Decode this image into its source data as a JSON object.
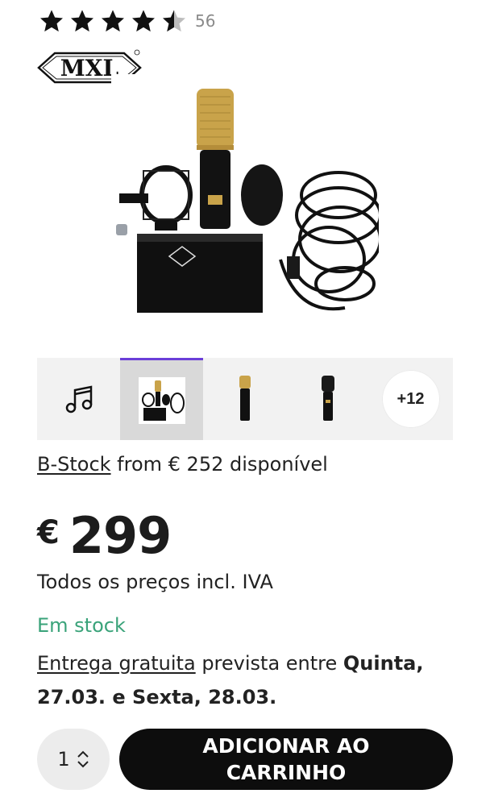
{
  "rating": {
    "value": 4.5,
    "max": 5,
    "count": "56"
  },
  "brand": {
    "name": "MXL"
  },
  "thumbnails": {
    "more_label": "+12",
    "icons": [
      "music-note-icon",
      "product-set-thumbnail",
      "microphone-gold-thumbnail",
      "microphone-black-thumbnail"
    ]
  },
  "bstock": {
    "link": "B-Stock",
    "text": " from € 252 disponível"
  },
  "price": {
    "currency": "€",
    "amount": "299"
  },
  "vat_note": "Todos os preços incl. IVA",
  "stock_status": "Em stock",
  "delivery": {
    "link": "Entrega gratuita",
    "text": " prevista entre ",
    "date1": "Quinta, 27.03.",
    "connector": " e ",
    "date2": "Sexta, 28.03."
  },
  "quantity": {
    "value": "1"
  },
  "cart_button": {
    "label": "ADICIONAR AO CARRINHO"
  },
  "colors": {
    "accent": "#6a3ed8",
    "stock": "#3aa37a",
    "button": "#0d0d0d"
  }
}
